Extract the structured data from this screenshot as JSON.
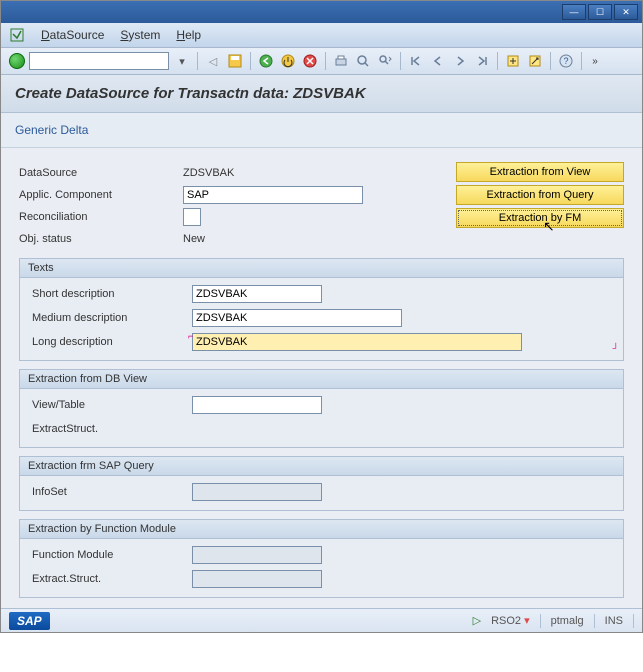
{
  "window": {
    "min": "—",
    "max": "☐",
    "close": "✕"
  },
  "menu": {
    "datasource": "DataSource",
    "system": "System",
    "help": "Help"
  },
  "title": "Create DataSource for Transactn data: ZDSVBAK",
  "subheader": "Generic Delta",
  "fields": {
    "datasource_label": "DataSource",
    "datasource_value": "ZDSVBAK",
    "applic_label": "Applic. Component",
    "applic_value": "SAP",
    "reconc_label": "Reconciliation",
    "reconc_value": "",
    "status_label": "Obj. status",
    "status_value": "New"
  },
  "buttons": {
    "ext_view": "Extraction from View",
    "ext_query": "Extraction from Query",
    "ext_fm": "Extraction by FM"
  },
  "texts": {
    "header": "Texts",
    "short_label": "Short description",
    "short_value": "ZDSVBAK",
    "medium_label": "Medium description",
    "medium_value": "ZDSVBAK",
    "long_label": "Long description",
    "long_value": "ZDSVBAK"
  },
  "dbview": {
    "header": "Extraction from DB View",
    "view_label": "View/Table",
    "view_value": "",
    "struct_label": "ExtractStruct.",
    "struct_value": ""
  },
  "sapquery": {
    "header": "Extraction frm SAP Query",
    "infoset_label": "InfoSet",
    "infoset_value": ""
  },
  "fm": {
    "header": "Extraction by Function Module",
    "fm_label": "Function Module",
    "fm_value": "",
    "struct_label": "Extract.Struct.",
    "struct_value": ""
  },
  "status": {
    "tcode": "RSO2",
    "user": "ptmalg",
    "mode": "INS"
  }
}
